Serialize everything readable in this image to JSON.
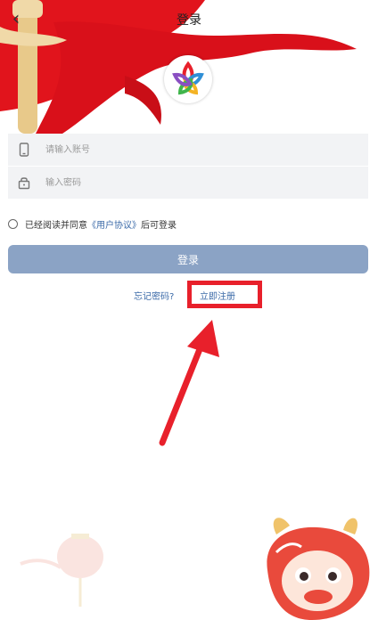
{
  "header": {
    "title": "登录",
    "back_icon": "chevron-left-icon"
  },
  "logo": {
    "icon": "star-ribbon-logo"
  },
  "account": {
    "placeholder": "请输入账号",
    "value": "",
    "icon": "phone-icon"
  },
  "password": {
    "placeholder": "输入密码",
    "value": "",
    "icon": "lock-icon"
  },
  "agreement": {
    "prefix": "已经阅读并同意",
    "link": "《用户协议》",
    "suffix": "后可登录",
    "checked": false
  },
  "login_button": {
    "label": "登录"
  },
  "links": {
    "forgot": "忘记密码?",
    "register": "立即注册"
  },
  "colors": {
    "primary_button": "#8ba3c5",
    "link": "#3b6aa8",
    "highlight": "#e8202b",
    "flag_red": "#e1141c",
    "input_bg": "#f2f3f5"
  }
}
